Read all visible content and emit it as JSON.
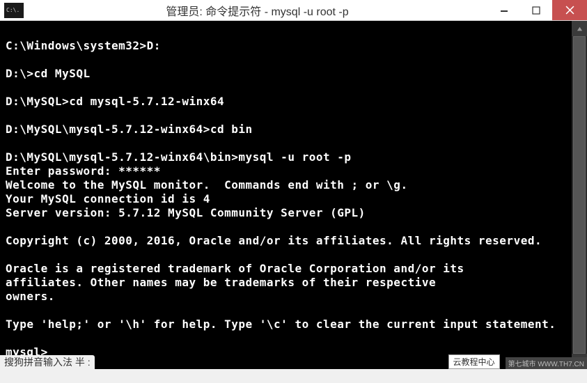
{
  "window": {
    "title": "管理员: 命令提示符 - mysql  -u root -p",
    "icon_glyph": "C:\\."
  },
  "terminal": {
    "lines": [
      "",
      "C:\\Windows\\system32>D:",
      "",
      "D:\\>cd MySQL",
      "",
      "D:\\MySQL>cd mysql-5.7.12-winx64",
      "",
      "D:\\MySQL\\mysql-5.7.12-winx64>cd bin",
      "",
      "D:\\MySQL\\mysql-5.7.12-winx64\\bin>mysql -u root -p",
      "Enter password: ******",
      "Welcome to the MySQL monitor.  Commands end with ; or \\g.",
      "Your MySQL connection id is 4",
      "Server version: 5.7.12 MySQL Community Server (GPL)",
      "",
      "Copyright (c) 2000, 2016, Oracle and/or its affiliates. All rights reserved.",
      "",
      "Oracle is a registered trademark of Oracle Corporation and/or its",
      "affiliates. Other names may be trademarks of their respective",
      "owners.",
      "",
      "Type 'help;' or '\\h' for help. Type '\\c' to clear the current input statement.",
      "",
      "mysql>"
    ]
  },
  "ime": {
    "text": "搜狗拼音输入法 半 :"
  },
  "labels": {
    "center": "云教程中心",
    "site": "第七城市   WWW.TH7.CN"
  }
}
